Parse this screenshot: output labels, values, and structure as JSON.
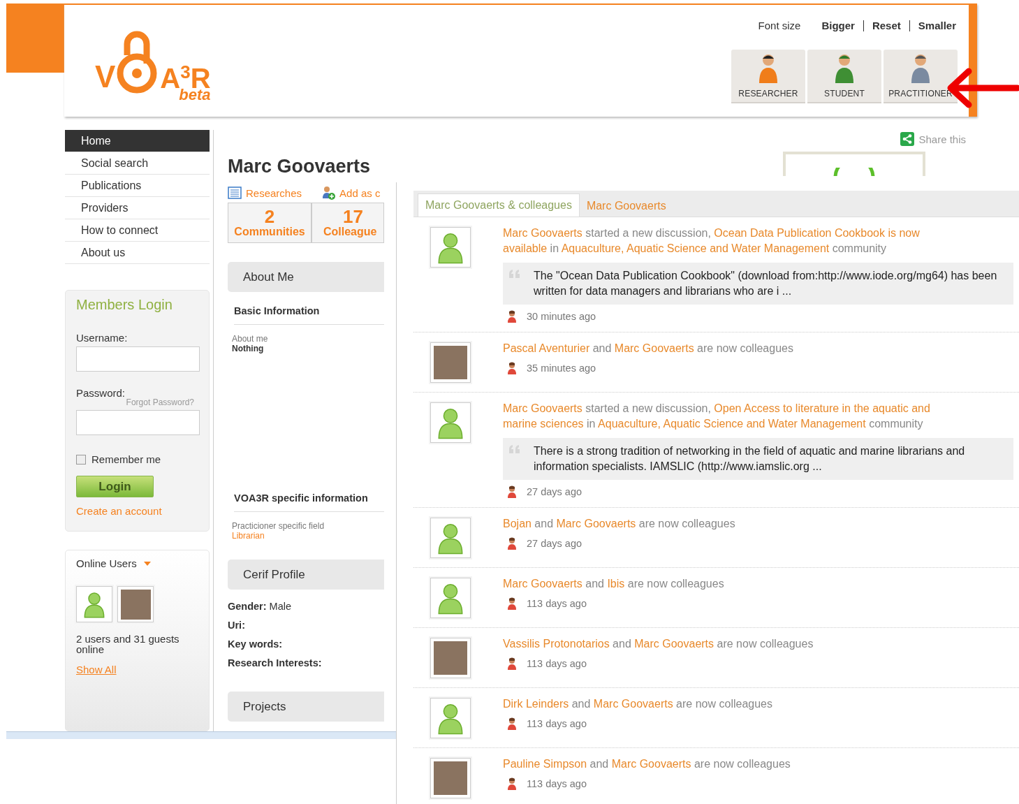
{
  "logo": {
    "before": "V",
    "after": "A$^{3}$R",
    "tag": "beta"
  },
  "font_size": {
    "label": "Font size",
    "options": [
      "Bigger",
      "Reset",
      "Smaller"
    ]
  },
  "roles": [
    {
      "label": "RESEARCHER",
      "kind": "researcher"
    },
    {
      "label": "STUDENT",
      "kind": "student"
    },
    {
      "label": "PRACTITIONER",
      "kind": "practitioner"
    }
  ],
  "nav": [
    {
      "label": "Home",
      "selected": true
    },
    {
      "label": "Social search",
      "selected": false
    },
    {
      "label": "Publications",
      "selected": false
    },
    {
      "label": "Providers",
      "selected": false
    },
    {
      "label": "How to connect",
      "selected": false
    },
    {
      "label": "About us",
      "selected": false
    }
  ],
  "login": {
    "title": "Members Login",
    "username_label": "Username:",
    "password_label": "Password:",
    "forgot": "Forgot Password?",
    "remember": {
      "label": "Remember me",
      "checked": false
    },
    "button": "Login",
    "create": "Create an account"
  },
  "online_users": {
    "title": "Online Users",
    "avatars": [
      {
        "photo": false
      },
      {
        "photo": true
      }
    ],
    "summary": "2 users and 31 guests online",
    "show_all": "Show All"
  },
  "profile": {
    "name": "Marc Goovaerts",
    "actions": [
      {
        "label": "Researches",
        "kind": "list"
      },
      {
        "label": "Add as c",
        "kind": "add"
      }
    ],
    "stats": [
      {
        "value": "2",
        "label": "Communities"
      },
      {
        "value": "17",
        "label": "Colleague"
      }
    ],
    "sections": [
      {
        "title": "About Me",
        "kind": "groups",
        "groups": [
          {
            "title": "Basic Information",
            "fields": [
              {
                "label": "About me",
                "value": "Nothing",
                "link": false
              }
            ]
          },
          {
            "title": "VOA3R specific information",
            "fields": [
              {
                "label": "Practicioner specific field",
                "value": "Librarian",
                "link": true
              }
            ]
          }
        ]
      },
      {
        "title": "Cerif Profile",
        "kind": "pairs",
        "pairs": [
          {
            "label": "Gender:",
            "value": "Male"
          },
          {
            "label": "Uri:"
          },
          {
            "label": "Key words:"
          },
          {
            "label": "Research Interests:"
          }
        ]
      },
      {
        "title": "Projects",
        "kind": "pairs"
      }
    ]
  },
  "share": "Share this",
  "tabs": [
    {
      "label": "Marc Goovaerts & colleagues",
      "selected": true
    },
    {
      "label": "Marc Goovaerts",
      "selected": false
    }
  ],
  "feed": [
    {
      "photo": false,
      "message": [
        {
          "text": "Marc Goovaerts",
          "link": true
        },
        {
          "text": " started a new discussion, ",
          "link": false
        },
        {
          "text": "Ocean Data Publication Cookbook is now available",
          "link": true
        },
        {
          "text": " in ",
          "link": false
        },
        {
          "text": "Aquaculture, Aquatic Science and Water Management",
          "link": true
        },
        {
          "text": " community",
          "link": false
        }
      ],
      "quote": "The \"Ocean Data Publication Cookbook\" (download from:http://www.iode.org/mg64) has been written for data managers and librarians who are i ...",
      "time": "30 minutes ago"
    },
    {
      "photo": true,
      "message": [
        {
          "text": "Pascal Aventurier",
          "link": true
        },
        {
          "text": " and ",
          "link": false
        },
        {
          "text": "Marc Goovaerts",
          "link": true
        },
        {
          "text": " are now colleagues",
          "link": false
        }
      ],
      "time": "35 minutes ago"
    },
    {
      "photo": false,
      "message": [
        {
          "text": "Marc Goovaerts",
          "link": true
        },
        {
          "text": " started a new discussion, ",
          "link": false
        },
        {
          "text": "Open Access to literature in the aquatic and marine sciences",
          "link": true
        },
        {
          "text": " in ",
          "link": false
        },
        {
          "text": "Aquaculture, Aquatic Science and Water Management",
          "link": true
        },
        {
          "text": " community",
          "link": false
        }
      ],
      "quote": "There is a strong tradition of networking in the field of aquatic and marine librarians and information specialists. IAMSLIC (http://www.iamslic.org ...",
      "time": "27 days ago"
    },
    {
      "photo": false,
      "message": [
        {
          "text": "Bojan",
          "link": true
        },
        {
          "text": " and ",
          "link": false
        },
        {
          "text": "Marc Goovaerts",
          "link": true
        },
        {
          "text": " are now colleagues",
          "link": false
        }
      ],
      "time": "27 days ago"
    },
    {
      "photo": false,
      "message": [
        {
          "text": "Marc Goovaerts",
          "link": true
        },
        {
          "text": " and ",
          "link": false
        },
        {
          "text": "Ibis",
          "link": true
        },
        {
          "text": " are now colleagues",
          "link": false
        }
      ],
      "time": "113 days ago"
    },
    {
      "photo": true,
      "message": [
        {
          "text": "Vassilis Protonotarios",
          "link": true
        },
        {
          "text": " and ",
          "link": false
        },
        {
          "text": "Marc Goovaerts",
          "link": true
        },
        {
          "text": " are now colleagues",
          "link": false
        }
      ],
      "time": "113 days ago"
    },
    {
      "photo": false,
      "message": [
        {
          "text": "Dirk Leinders",
          "link": true
        },
        {
          "text": " and ",
          "link": false
        },
        {
          "text": "Marc Goovaerts",
          "link": true
        },
        {
          "text": " are now colleagues",
          "link": false
        }
      ],
      "time": "113 days ago"
    },
    {
      "photo": true,
      "message": [
        {
          "text": "Pauline Simpson",
          "link": true
        },
        {
          "text": " and ",
          "link": false
        },
        {
          "text": "Marc Goovaerts",
          "link": true
        },
        {
          "text": " are now colleagues",
          "link": false
        }
      ],
      "time": "113 days ago"
    }
  ]
}
